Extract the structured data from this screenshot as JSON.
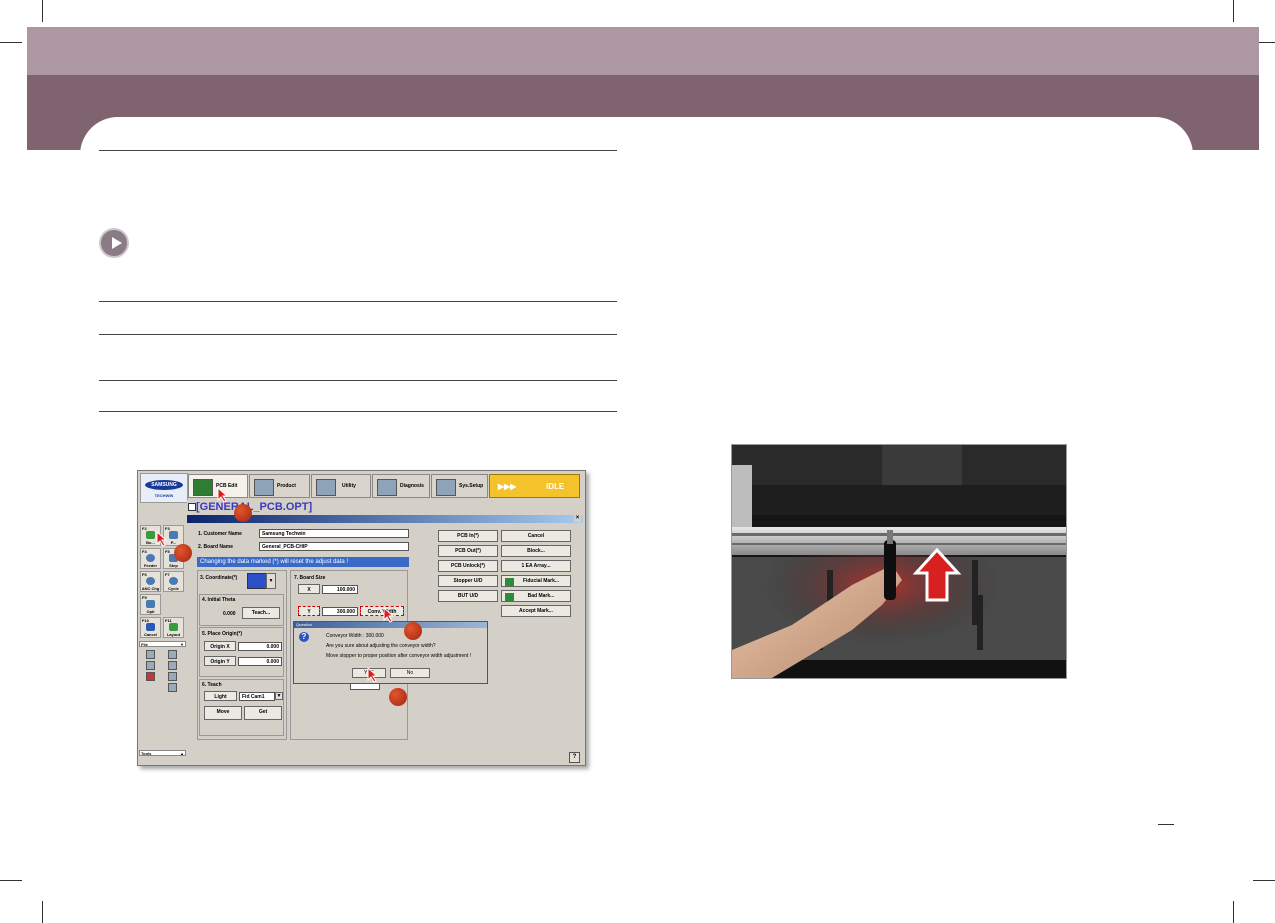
{
  "software": {
    "logo": {
      "brand": "SAMSUNG",
      "sub": "TECHWIN"
    },
    "tabs": [
      {
        "label": "PCB Edit",
        "icon": "pcb-edit-icon",
        "active": true
      },
      {
        "label": "Product",
        "icon": "product-icon"
      },
      {
        "label": "Utility",
        "icon": "utility-icon"
      },
      {
        "label": "Diagnosis",
        "icon": "diagnosis-icon"
      },
      {
        "label": "Sys.Setup",
        "icon": "sys-setup-icon"
      }
    ],
    "status": {
      "arrows": "▶▶▶",
      "text": "IDLE",
      "color": "#f4c22b"
    },
    "file_title": "[GENERAL_PCB.OPT]",
    "sidebar_keys": [
      {
        "key": "F2",
        "name": "Bo..."
      },
      {
        "key": "F3",
        "name": "P..."
      },
      {
        "key": "F4",
        "name": "Feeder"
      },
      {
        "key": "F5",
        "name": "Step"
      },
      {
        "key": "F6",
        "name": "ANC Chg"
      },
      {
        "key": "F7",
        "name": "Cycle"
      },
      {
        "key": "F9",
        "name": "Opti"
      },
      {
        "key": "F10",
        "name": "Cancel"
      },
      {
        "key": "F11",
        "name": "Layout"
      }
    ],
    "file_label": "File",
    "tools_label": "Tools",
    "fields": {
      "customer_label": "1. Customer Name",
      "customer_value": "Samsung Techwin",
      "board_label": "2. Board Name",
      "board_value": "General_PCB-CHIP",
      "warning": "Changing the data marked (*) will reset the adjust data !",
      "coordinate_label": "3. Coordinate(*)",
      "theta_label": "4. Initial Theta",
      "theta_value": "0.000",
      "teach_btn": "Teach...",
      "place_origin_label": "5. Place Origin(*)",
      "origin_x_label": "Origin X",
      "origin_x_value": "0.000",
      "origin_y_label": "Origin Y",
      "origin_y_value": "0.000",
      "teach_label": "6. Teach",
      "light_label": "Light",
      "fid_value": "Fid Cam1",
      "move_label": "Move",
      "get_label": "Get",
      "board_size_label": "7. Board Size",
      "x_label": "X",
      "x_value": "100.000",
      "y_label": "Y",
      "y_value": "300.000",
      "conv_width_label": "Conv. Width"
    },
    "right_buttons": [
      {
        "label": "PCB In(*)"
      },
      {
        "label": "PCB Out(*)"
      },
      {
        "label": "PCB Unlock(*)"
      },
      {
        "label": "Stopper U/D"
      },
      {
        "label": "BUT U/D"
      }
    ],
    "right_buttons2": [
      {
        "label": "Cancel"
      },
      {
        "label": "Block..."
      },
      {
        "label": "1 EA     Array..."
      },
      {
        "label": "Fiducial Mark..."
      },
      {
        "label": "Bad Mark..."
      },
      {
        "label": "Accept Mark..."
      }
    ],
    "dialog": {
      "title": "Question",
      "line1": "Conveyor Width : 300.000",
      "line2": "Are you sure about adjusting the conveyor width?",
      "line3": "Move stopper to proper position after conveyor width adjustment !",
      "yes": "YES",
      "no": "No"
    },
    "help": "?"
  }
}
